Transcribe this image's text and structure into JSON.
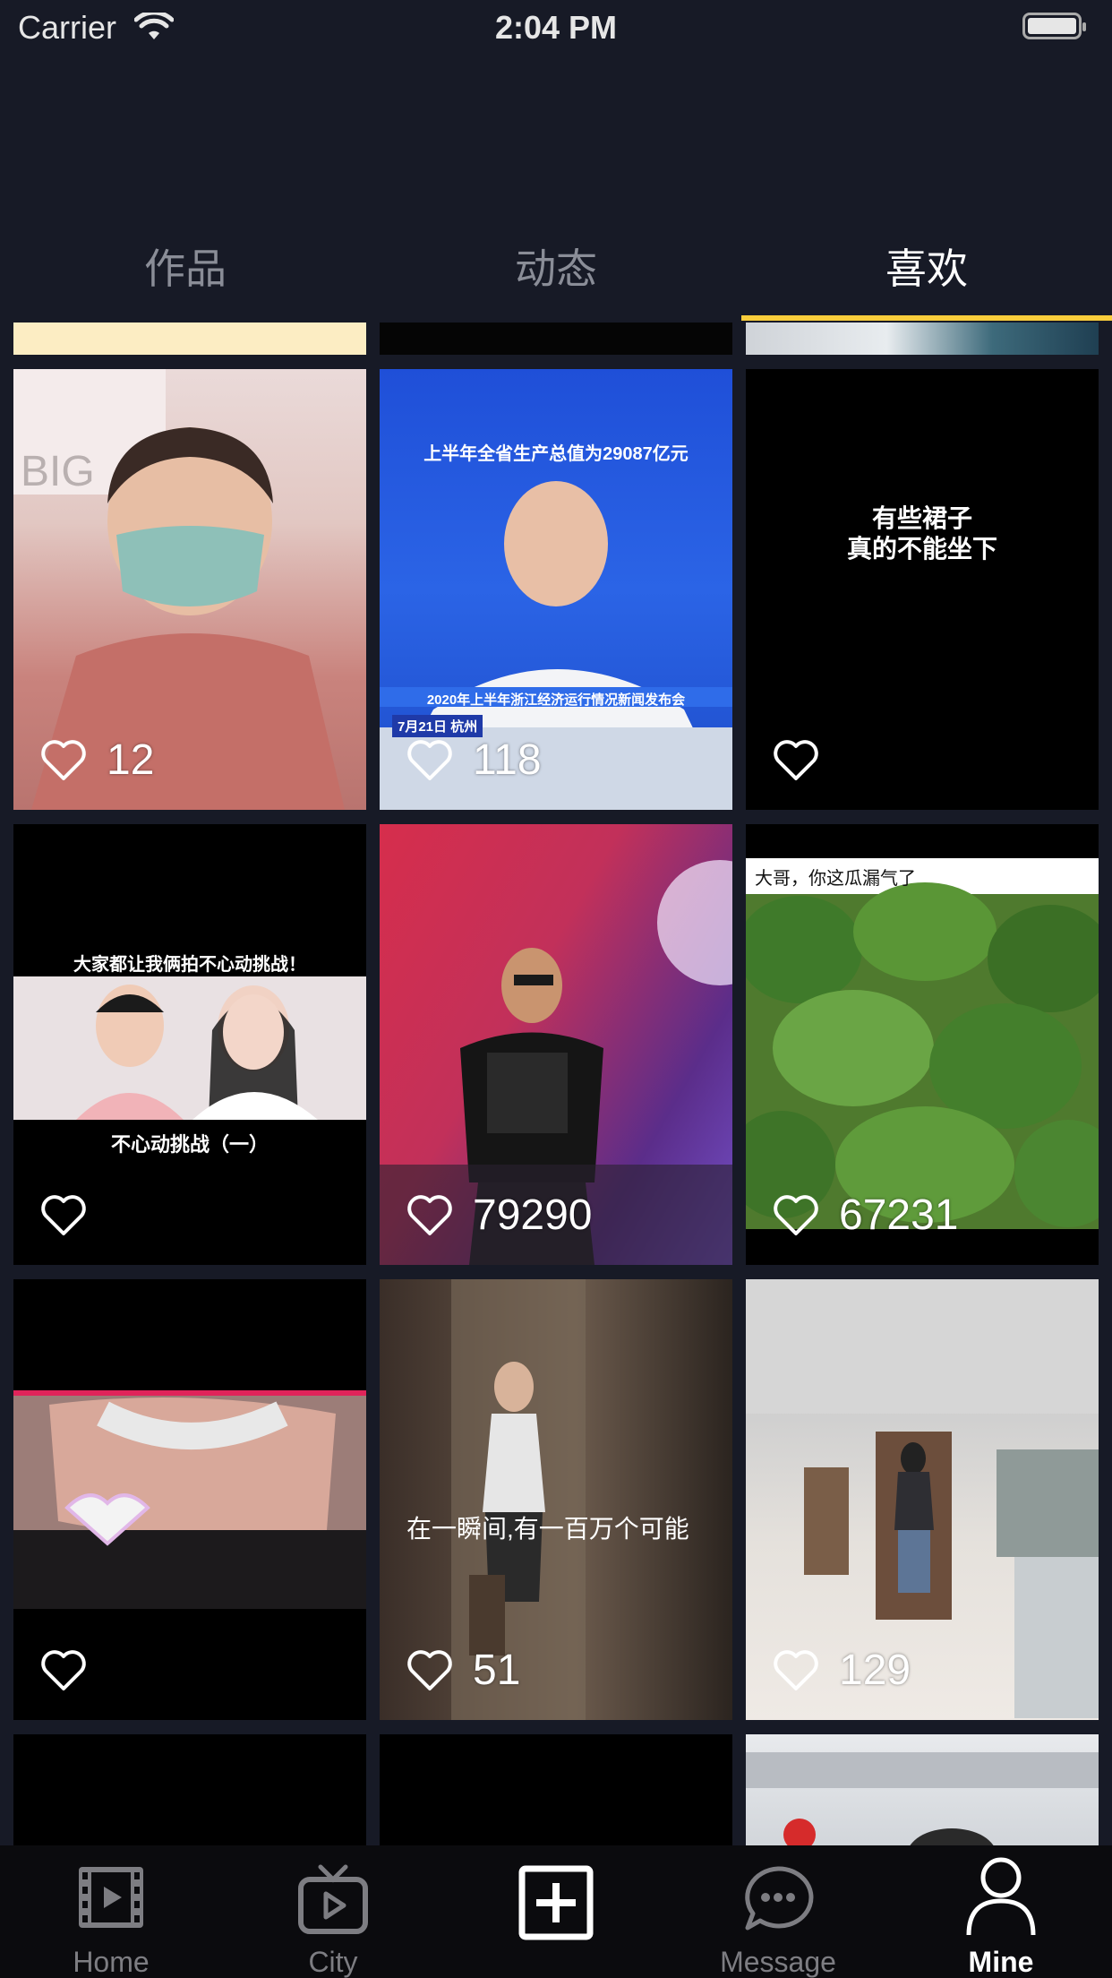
{
  "status_bar": {
    "carrier": "Carrier",
    "time": "2:04 PM"
  },
  "tabs": [
    {
      "label": "作品"
    },
    {
      "label": "动态"
    },
    {
      "label": "喜欢"
    }
  ],
  "active_tab": 2,
  "accent_color": "#f9cd3b",
  "grid": [
    {
      "likes": "12"
    },
    {
      "likes": "118",
      "caption_top": "上半年全省生产总值为29087亿元",
      "caption_bottom": "2020年上半年浙江经济运行情况新闻发布会",
      "caption_tag": "7月21日 杭州"
    },
    {
      "likes": "",
      "caption": "有些裙子\n真的不能坐下"
    },
    {
      "likes": "",
      "caption_top": "大家都让我俩拍不心动挑战！",
      "caption_bottom": "不心动挑战（一）"
    },
    {
      "likes": "79290"
    },
    {
      "likes": "67231",
      "caption_top": "大哥，你这瓜漏气了"
    },
    {
      "likes": ""
    },
    {
      "likes": "51",
      "caption": "在一瞬间,有一百万个可能"
    },
    {
      "likes": "129"
    }
  ],
  "bottom_nav": [
    {
      "label": "Home",
      "icon": "film-icon"
    },
    {
      "label": "City",
      "icon": "tv-play-icon"
    },
    {
      "label": "",
      "icon": "add-square-icon"
    },
    {
      "label": "Message",
      "icon": "chat-bubble-icon"
    },
    {
      "label": "Mine",
      "icon": "person-icon"
    }
  ],
  "active_nav": 4
}
